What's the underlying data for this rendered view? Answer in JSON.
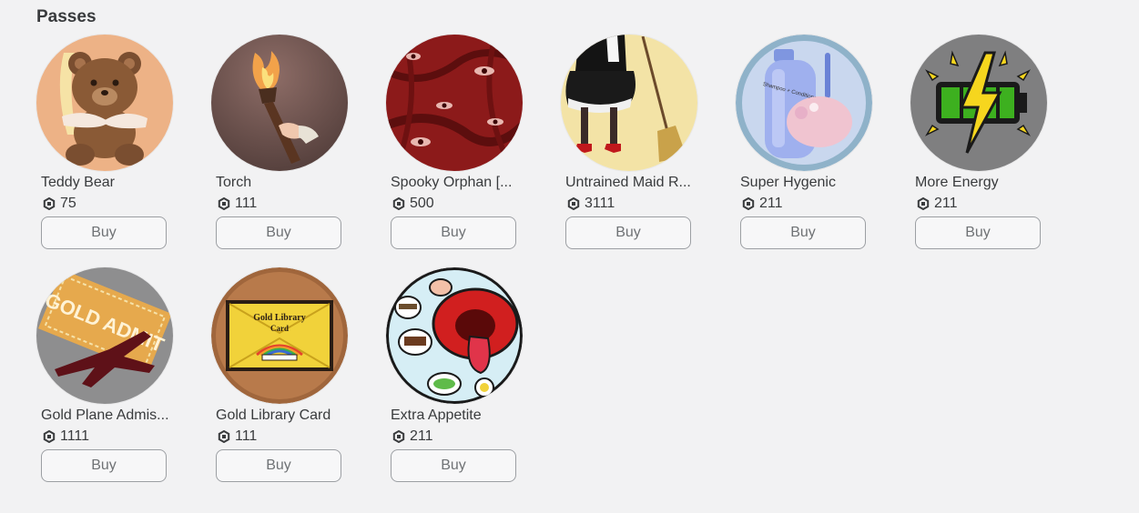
{
  "section": {
    "title": "Passes"
  },
  "passes": [
    {
      "name": "Teddy Bear",
      "price": "75",
      "buy_label": "Buy",
      "icon": "teddy-bear-icon"
    },
    {
      "name": "Torch",
      "price": "111",
      "buy_label": "Buy",
      "icon": "torch-icon"
    },
    {
      "name": "Spooky Orphan [...",
      "price": "500",
      "buy_label": "Buy",
      "icon": "spooky-eyes-icon"
    },
    {
      "name": "Untrained Maid R...",
      "price": "3111",
      "buy_label": "Buy",
      "icon": "maid-broom-icon"
    },
    {
      "name": "Super Hygenic",
      "price": "211",
      "buy_label": "Buy",
      "icon": "shampoo-bottle-icon"
    },
    {
      "name": "More Energy",
      "price": "211",
      "buy_label": "Buy",
      "icon": "battery-lightning-icon"
    },
    {
      "name": "Gold Plane Admis...",
      "price": "1111",
      "buy_label": "Buy",
      "icon": "gold-plane-ticket-icon"
    },
    {
      "name": "Gold Library Card",
      "price": "111",
      "buy_label": "Buy",
      "icon": "library-card-icon"
    },
    {
      "name": "Extra Appetite",
      "price": "211",
      "buy_label": "Buy",
      "icon": "mouth-food-icon"
    }
  ],
  "thumb_text": {
    "shampoo_label": "Shampoo + Conditioner",
    "gold_admit": "GOLD ADMIT",
    "library_card_title": "Gold Library",
    "library_card_sub": "Card"
  },
  "currency_icon": "robux-icon",
  "colors": {
    "background": "#f2f2f3",
    "text": "#393b3d",
    "button_border": "#9c9fa3",
    "button_text": "#6f7275"
  }
}
